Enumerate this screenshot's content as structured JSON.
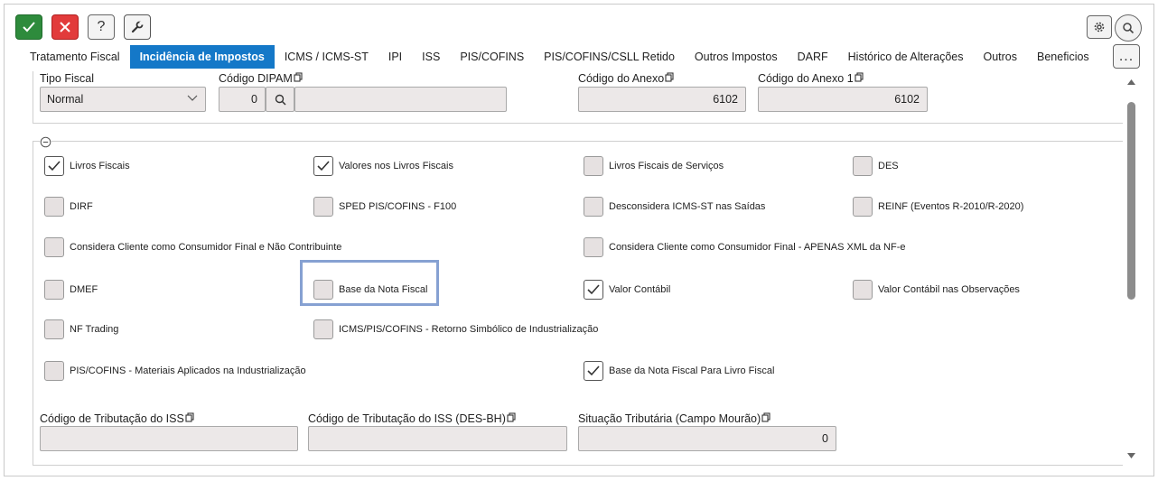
{
  "toolbar": {
    "help_label": "?",
    "more_label": "..."
  },
  "tabs": [
    {
      "label": "Tratamento Fiscal",
      "active": false
    },
    {
      "label": "Incidência de Impostos",
      "active": true
    },
    {
      "label": "ICMS / ICMS-ST",
      "active": false
    },
    {
      "label": "IPI",
      "active": false
    },
    {
      "label": "ISS",
      "active": false
    },
    {
      "label": "PIS/COFINS",
      "active": false
    },
    {
      "label": "PIS/COFINS/CSLL Retido",
      "active": false
    },
    {
      "label": "Outros Impostos",
      "active": false
    },
    {
      "label": "DARF",
      "active": false
    },
    {
      "label": "Histórico de Alterações",
      "active": false
    },
    {
      "label": "Outros",
      "active": false
    },
    {
      "label": "Beneficios",
      "active": false
    }
  ],
  "top_fields": {
    "tipo_fiscal": {
      "label": "Tipo Fiscal",
      "value": "Normal"
    },
    "codigo_dipam": {
      "label": "Código DIPAM",
      "value": "0",
      "description": ""
    },
    "codigo_anexo": {
      "label": "Código do Anexo",
      "value": "6102"
    },
    "codigo_anexo1": {
      "label": "Código do Anexo 1",
      "value": "6102"
    }
  },
  "checkboxes": [
    {
      "label": "Livros Fiscais",
      "checked": true
    },
    {
      "label": "Valores nos Livros Fiscais",
      "checked": true
    },
    {
      "label": "Livros Fiscais de Serviços",
      "checked": false
    },
    {
      "label": "DES",
      "checked": false
    },
    {
      "label": "DIRF",
      "checked": false
    },
    {
      "label": "SPED PIS/COFINS - F100",
      "checked": false
    },
    {
      "label": "Desconsidera ICMS-ST nas Saídas",
      "checked": false
    },
    {
      "label": "REINF (Eventos R-2010/R-2020)",
      "checked": false
    },
    {
      "label": "Considera Cliente como Consumidor Final e Não Contribuinte",
      "checked": false
    },
    {
      "label": "Considera Cliente como Consumidor Final - APENAS XML da NF-e",
      "checked": false
    },
    {
      "label": "DMEF",
      "checked": false
    },
    {
      "label": "Base da Nota Fiscal",
      "checked": false
    },
    {
      "label": "Valor Contábil",
      "checked": true
    },
    {
      "label": "Valor Contábil nas Observações",
      "checked": false
    },
    {
      "label": "NF Trading",
      "checked": false
    },
    {
      "label": "ICMS/PIS/COFINS - Retorno Simbólico de Industrialização",
      "checked": false
    },
    {
      "label": "PIS/COFINS - Materiais Aplicados na Industrialização",
      "checked": false
    },
    {
      "label": "Base da Nota Fiscal Para Livro Fiscal",
      "checked": true
    }
  ],
  "bottom_fields": {
    "cod_trib_iss": {
      "label": "Código de Tributação do ISS",
      "value": ""
    },
    "cod_trib_iss_desbh": {
      "label": "Código de Tributação do ISS (DES-BH)",
      "value": ""
    },
    "sit_trib_campo_mourao": {
      "label": "Situação Tributária (Campo Mourão)",
      "value": "0"
    }
  },
  "colors": {
    "accent": "#1478c8",
    "ok": "#2e8b3c",
    "cancel": "#e23b3b",
    "highlight": "#86a1d2"
  }
}
